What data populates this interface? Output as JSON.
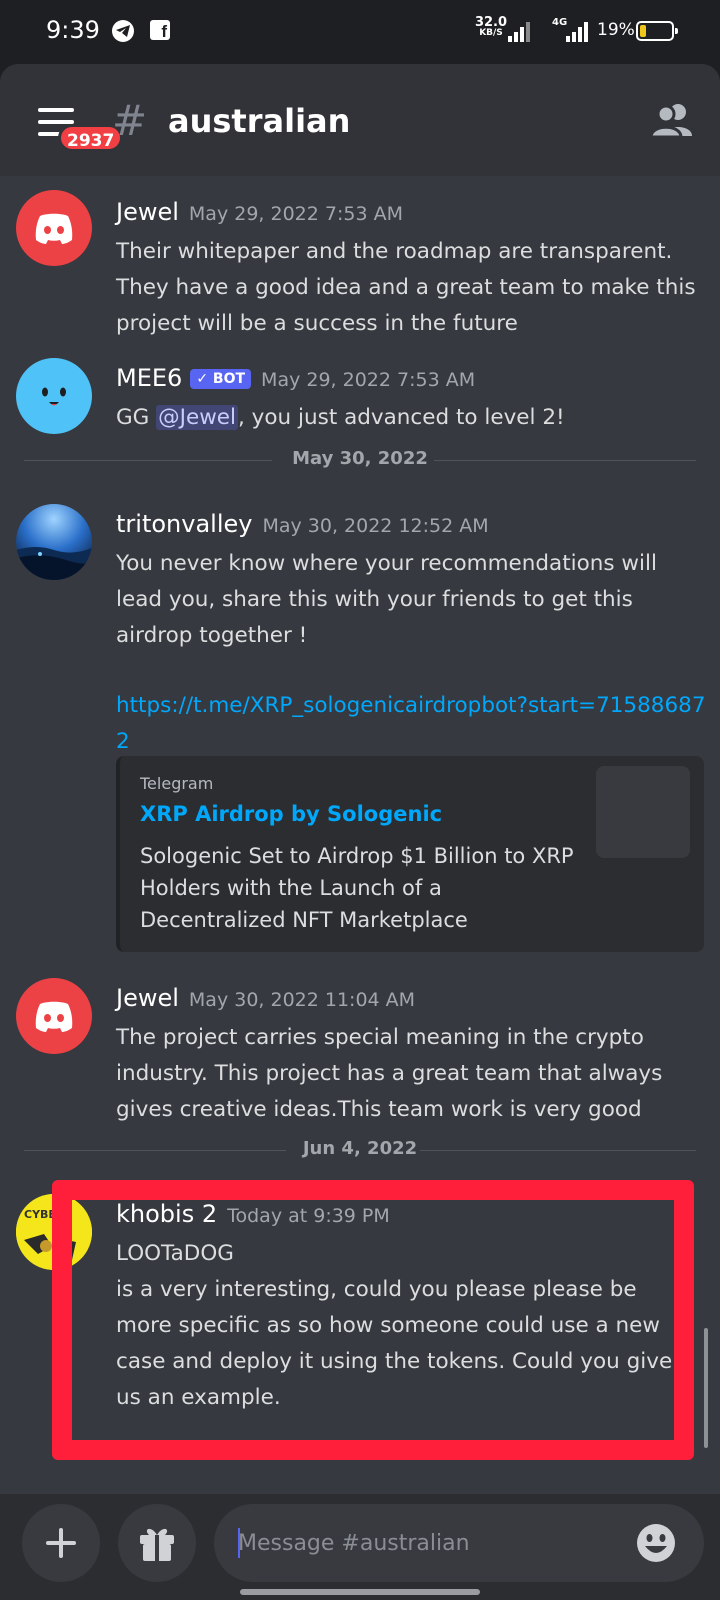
{
  "status_bar": {
    "time": "9:39",
    "net_speed_value": "32.0",
    "net_speed_unit": "KB/S",
    "network_label": "4G",
    "battery_pct": "19%",
    "battery_level": 0.19,
    "battery_color": "#f0c61a"
  },
  "header": {
    "badge_count": "2937",
    "hash": "#",
    "channel_name": "australian"
  },
  "messages": [
    {
      "author": "Jewel",
      "timestamp": "May 29, 2022 7:53 AM",
      "avatar_icon": "discord-logo-icon",
      "avatar_color": "#ed4245",
      "text": "Their whitepaper and the roadmap are transparent. They have a good idea and a great team to make this project will be a success in the future"
    },
    {
      "author": "MEE6",
      "bot_tag": "✓ BOT",
      "timestamp": "May 29, 2022 7:53 AM",
      "avatar_icon": "mee6-face-icon",
      "avatar_color": "#4fc3f7",
      "text_prefix": "GG ",
      "mention": "@Jewel",
      "text_suffix": ", you just advanced to level 2!"
    },
    {
      "author": "tritonvalley",
      "timestamp": "May 30, 2022 12:52 AM",
      "avatar_icon": "landscape-avatar-icon",
      "text": "You never know where your recommendations will lead you, share this with your friends to get this airdrop together !",
      "link": "https://t.me/XRP_sologenicairdropbot?start=715886872",
      "embed": {
        "provider": "Telegram",
        "title": "XRP Airdrop by Sologenic",
        "description": "Sologenic Set to Airdrop $1 Billion to XRP Holders with the Launch of a Decentralized NFT Marketplace"
      }
    },
    {
      "author": "Jewel",
      "timestamp": "May 30, 2022 11:04 AM",
      "avatar_icon": "discord-logo-icon",
      "avatar_color": "#ed4245",
      "text": "The project carries special meaning in the crypto industry.  This project has a great team that always gives creative ideas.This team work is very good"
    },
    {
      "author": "khobis 2",
      "timestamp": "Today at 9:39 PM",
      "avatar_icon": "cyberpunk-avatar-icon",
      "avatar_color": "#f5e61c",
      "line1": "LOOTaDOG",
      "text": "is a very interesting, could you please please be more specific as so how someone could use a new case and deploy it using the tokens. Could you give us an example."
    }
  ],
  "dividers": [
    "May 30, 2022",
    "Jun 4, 2022"
  ],
  "highlight_color": "#ff1f3a",
  "composer": {
    "placeholder": "Message #australian"
  },
  "icons": {
    "add": "plus-icon",
    "gift": "gift-icon",
    "emoji": "emoji-icon",
    "members": "members-icon",
    "menu": "hamburger-icon"
  }
}
